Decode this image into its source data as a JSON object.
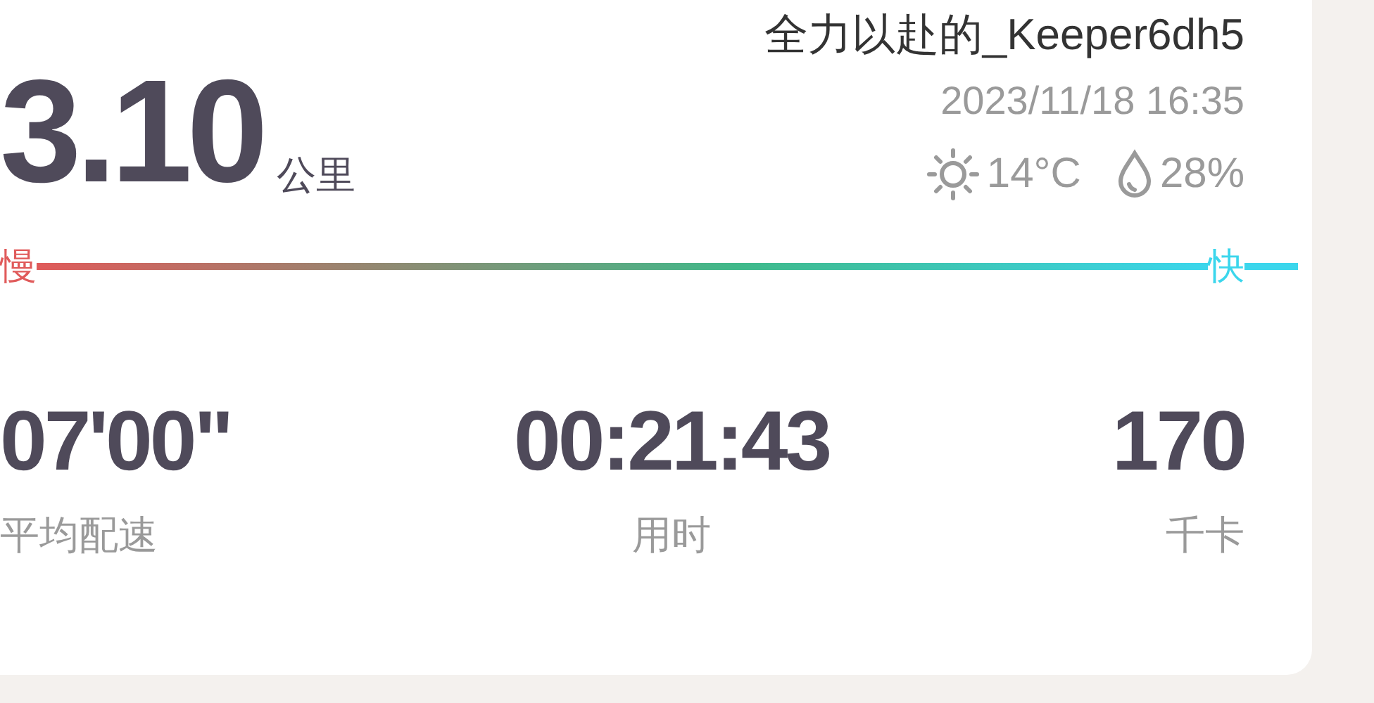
{
  "distance": {
    "value": "3.10",
    "unit": "公里"
  },
  "user": {
    "name": "全力以赴的_Keeper6dh5",
    "datetime": "2023/11/18 16:35"
  },
  "weather": {
    "temperature": "14°C",
    "humidity": "28%"
  },
  "pace_scale": [
    {
      "label": "慢",
      "color": "#e05a5a"
    },
    {
      "label": "快",
      "color": "#3bd6ec"
    }
  ],
  "stats": [
    {
      "value": "07'00\"",
      "label": "平均配速"
    },
    {
      "value": "00:21:43",
      "label": "用时"
    },
    {
      "value": "170",
      "label": "千卡"
    }
  ]
}
